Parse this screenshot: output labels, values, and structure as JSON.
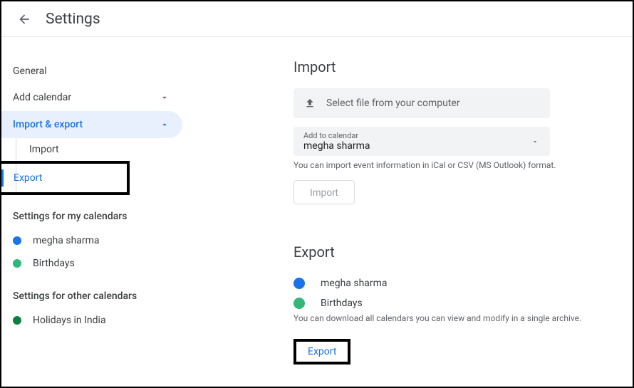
{
  "header": {
    "title": "Settings"
  },
  "sidebar": {
    "general": "General",
    "add_calendar": "Add calendar",
    "import_export": "Import & export",
    "sub": {
      "import": "Import",
      "export": "Export"
    },
    "my_calendars_heading": "Settings for my calendars",
    "my_calendars": [
      {
        "label": "megha sharma",
        "color": "#1a73e8"
      },
      {
        "label": "Birthdays",
        "color": "#33b679"
      }
    ],
    "other_calendars_heading": "Settings for other calendars",
    "other_calendars": [
      {
        "label": "Holidays in India",
        "color": "#0b8043"
      }
    ]
  },
  "main": {
    "import": {
      "title": "Import",
      "file_select": "Select file from your computer",
      "dropdown_label": "Add to calendar",
      "dropdown_value": "megha sharma",
      "help": "You can import event information in iCal or CSV (MS Outlook) format.",
      "button": "Import"
    },
    "export": {
      "title": "Export",
      "calendars": [
        {
          "label": "megha sharma",
          "color": "#1a73e8"
        },
        {
          "label": "Birthdays",
          "color": "#33b679"
        }
      ],
      "help": "You can download all calendars you can view and modify in a single archive.",
      "button": "Export"
    }
  }
}
